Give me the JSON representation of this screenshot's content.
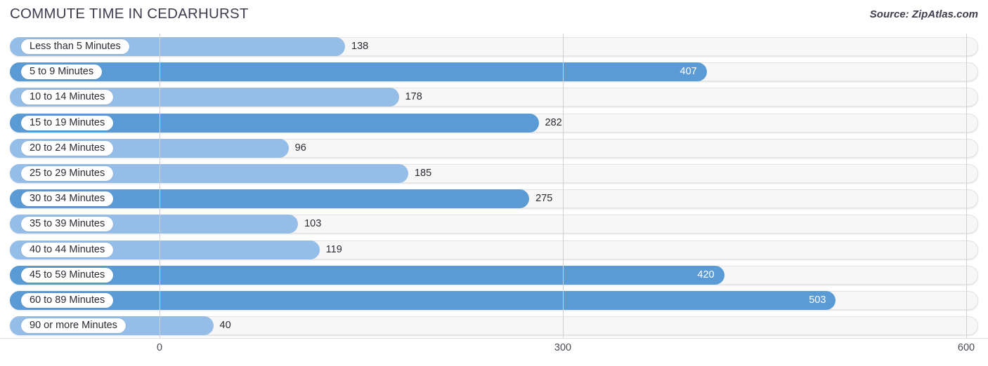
{
  "header": {
    "title": "COMMUTE TIME IN CEDARHURST",
    "source": "Source: ZipAtlas.com"
  },
  "colors": {
    "bar_light": "#94bde8",
    "bar_dark": "#5b9bd5",
    "track": "#f7f7f7",
    "gridline": "#d0d0d0",
    "title_text": "#3d3d4e"
  },
  "chart_data": {
    "type": "bar",
    "orientation": "horizontal",
    "title": "COMMUTE TIME IN CEDARHURST",
    "subtitle": "Source: ZipAtlas.com",
    "xlabel": "",
    "ylabel": "",
    "xlim": [
      0,
      600
    ],
    "xticks": [
      0,
      300,
      600
    ],
    "xtick_labels": [
      "0",
      "300",
      "600"
    ],
    "grid": true,
    "legend": "none",
    "categories": [
      "Less than 5 Minutes",
      "5 to 9 Minutes",
      "10 to 14 Minutes",
      "15 to 19 Minutes",
      "20 to 24 Minutes",
      "25 to 29 Minutes",
      "30 to 34 Minutes",
      "35 to 39 Minutes",
      "40 to 44 Minutes",
      "45 to 59 Minutes",
      "60 to 89 Minutes",
      "90 or more Minutes"
    ],
    "values": [
      138,
      407,
      178,
      282,
      96,
      185,
      275,
      103,
      119,
      420,
      503,
      40
    ],
    "value_labels": [
      "138",
      "407",
      "178",
      "282",
      "96",
      "185",
      "275",
      "103",
      "119",
      "420",
      "503",
      "40"
    ],
    "label_position": [
      "outside",
      "inside",
      "outside",
      "outside",
      "outside",
      "outside",
      "outside",
      "outside",
      "outside",
      "inside",
      "inside",
      "outside"
    ],
    "bar_shade": [
      "light",
      "dark",
      "light",
      "dark",
      "light",
      "light",
      "dark",
      "light",
      "light",
      "dark",
      "dark",
      "light"
    ]
  }
}
